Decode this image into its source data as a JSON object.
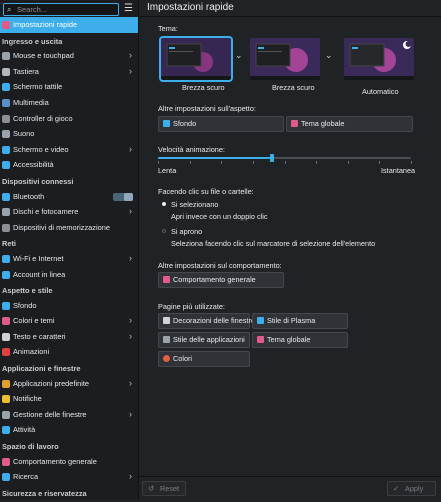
{
  "search": {
    "placeholder": "Search..."
  },
  "sidebar": {
    "top_item": "Impostazioni rapide",
    "sections": [
      {
        "title": "Ingresso e uscita",
        "items": [
          {
            "label": "Mouse e touchpad",
            "chev": true,
            "color": "#9aa3ab"
          },
          {
            "label": "Tastiera",
            "chev": true,
            "color": "#b0b6bc"
          },
          {
            "label": "Schermo tattile",
            "chev": false,
            "color": "#3daee9"
          },
          {
            "label": "Multimedia",
            "chev": false,
            "color": "#5a8fc8"
          },
          {
            "label": "Controller di gioco",
            "chev": false,
            "color": "#8a8f94"
          },
          {
            "label": "Suono",
            "chev": false,
            "color": "#9aa3ab"
          },
          {
            "label": "Schermo e video",
            "chev": true,
            "color": "#3daee9"
          },
          {
            "label": "Accessibilità",
            "chev": false,
            "color": "#3daee9"
          }
        ]
      },
      {
        "title": "Dispositivi connessi",
        "items": [
          {
            "label": "Bluetooth",
            "chev": false,
            "toggle": true,
            "color": "#3daee9"
          },
          {
            "label": "Dischi e fotocamere",
            "chev": true,
            "color": "#9aa3ab"
          },
          {
            "label": "Dispositivi di memorizzazione",
            "chev": false,
            "color": "#8a8f94"
          }
        ]
      },
      {
        "title": "Reti",
        "items": [
          {
            "label": "Wi-Fi e Internet",
            "chev": true,
            "color": "#3daee9"
          },
          {
            "label": "Account in linea",
            "chev": false,
            "color": "#3daee9"
          }
        ]
      },
      {
        "title": "Aspetto e stile",
        "items": [
          {
            "label": "Sfondo",
            "chev": false,
            "color": "#3daee9"
          },
          {
            "label": "Colori e temi",
            "chev": true,
            "color": "#e05a8a"
          },
          {
            "label": "Testo e caratteri",
            "chev": true,
            "color": "#d0d3d6"
          },
          {
            "label": "Animazioni",
            "chev": false,
            "color": "#e04040"
          }
        ]
      },
      {
        "title": "Applicazioni e finestre",
        "items": [
          {
            "label": "Applicazioni predefinite",
            "chev": true,
            "color": "#e0a030"
          },
          {
            "label": "Notifiche",
            "chev": false,
            "color": "#e8c030"
          },
          {
            "label": "Gestione delle finestre",
            "chev": true,
            "color": "#9aa3ab"
          },
          {
            "label": "Attività",
            "chev": false,
            "color": "#3daee9"
          }
        ]
      },
      {
        "title": "Spazio di lavoro",
        "items": [
          {
            "label": "Comportamento generale",
            "chev": false,
            "color": "#e05a8a"
          },
          {
            "label": "Ricerca",
            "chev": true,
            "color": "#3daee9"
          }
        ]
      },
      {
        "title": "Sicurezza e riservatezza",
        "items": []
      }
    ]
  },
  "main": {
    "title": "Impostazioni rapide",
    "theme_label": "Tema:",
    "themes": [
      {
        "name": "Brezza scuro",
        "selected": true
      },
      {
        "name": "Brezza scuro",
        "selected": false
      },
      {
        "name": "Automatico",
        "selected": false
      }
    ],
    "appearance_label": "Altre impostazioni sull'aspetto:",
    "appearance_buttons": [
      "Sfondo",
      "Tema globale"
    ],
    "anim_label": "Velocità animazione:",
    "anim_min": "Lenta",
    "anim_max": "Istantanea",
    "anim_value": 0.45,
    "click_label": "Facendo clic su file o cartelle:",
    "click_option1": "Si selezionano",
    "click_option1_hint": "Apri invece con un doppio clic",
    "click_option2": "Si aprono",
    "click_option2_hint": "Seleziona facendo clic sul marcatore di selezione dell'elemento",
    "behavior_label": "Altre impostazioni sul comportamento:",
    "behavior_button": "Comportamento generale",
    "most_used_label": "Pagine più utilizzate:",
    "most_used": [
      "Decorazioni delle finestre",
      "Stile di Plasma",
      "Stile delle applicazioni",
      "Tema globale",
      "Colori"
    ]
  },
  "footer": {
    "reset": "Reset",
    "apply": "Apply"
  },
  "colors": {
    "accent": "#3daee9"
  }
}
